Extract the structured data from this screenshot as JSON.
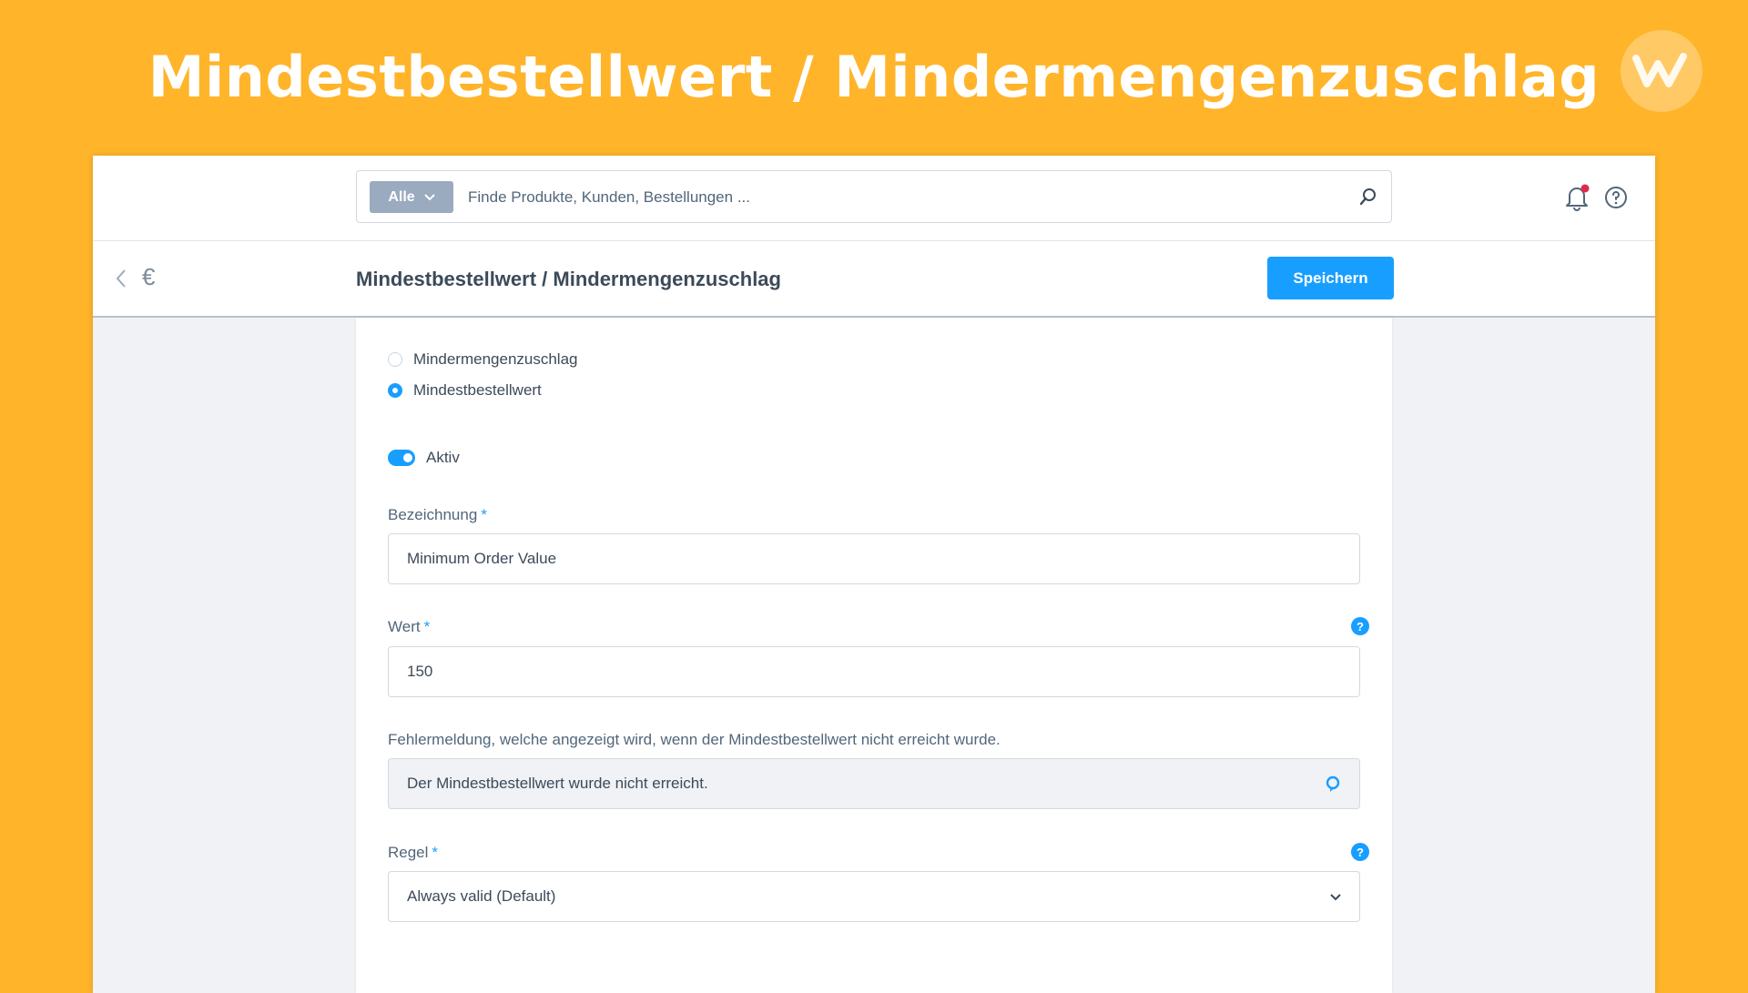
{
  "banner": {
    "title": "Mindestbestellwert / Mindermengenzuschlag"
  },
  "header": {
    "search_filter": "Alle",
    "search_placeholder": "Finde Produkte, Kunden, Bestellungen ..."
  },
  "smartbar": {
    "title": "Mindestbestellwert / Mindermengenzuschlag",
    "save_label": "Speichern"
  },
  "form": {
    "type_options": [
      {
        "label": "Mindermengenzuschlag",
        "checked": false
      },
      {
        "label": "Mindestbestellwert",
        "checked": true
      }
    ],
    "active_label": "Aktiv",
    "active": true,
    "name_label": "Bezeichnung",
    "name_value": "Minimum Order Value",
    "value_label": "Wert",
    "value_value": "150",
    "error_label": "Fehlermeldung, welche angezeigt wird, wenn der Mindestbestellwert nicht erreicht wurde.",
    "error_value": "Der Mindestbestellwert wurde nicht erreicht.",
    "rule_label": "Regel",
    "rule_value": "Always valid (Default)",
    "required_marker": "*",
    "help_glyph": "?"
  },
  "colors": {
    "background": "#FFB42A",
    "accent": "#189eff",
    "notification_dot": "#de294c"
  },
  "icons": [
    "logo-icon",
    "chevron-down-icon",
    "search-icon",
    "bell-icon",
    "help-icon",
    "back-icon",
    "euro-icon",
    "translate-icon"
  ]
}
